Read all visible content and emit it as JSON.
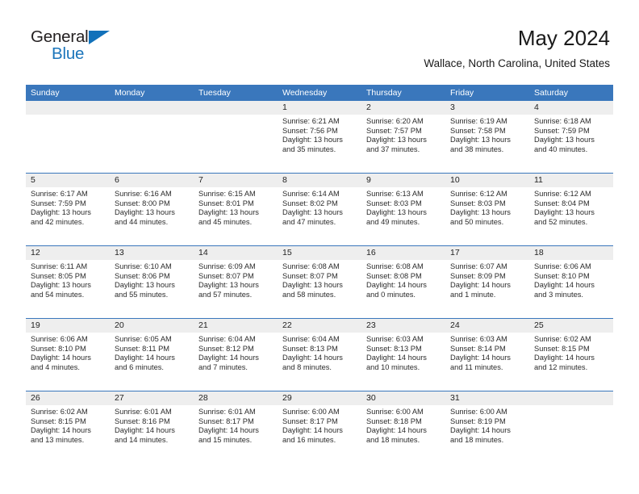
{
  "logo": {
    "line1": "General",
    "line2": "Blue",
    "triangle_color": "#1271ba",
    "blue_color": "#1b75bb"
  },
  "header": {
    "title": "May 2024",
    "subtitle": "Wallace, North Carolina, United States"
  },
  "theme": {
    "header_blue": "#3a77bc",
    "day_band_gray": "#eeeeee"
  },
  "weekdays": [
    "Sunday",
    "Monday",
    "Tuesday",
    "Wednesday",
    "Thursday",
    "Friday",
    "Saturday"
  ],
  "weeks": [
    [
      {
        "day": "",
        "lines": []
      },
      {
        "day": "",
        "lines": []
      },
      {
        "day": "",
        "lines": []
      },
      {
        "day": "1",
        "lines": [
          "Sunrise: 6:21 AM",
          "Sunset: 7:56 PM",
          "Daylight: 13 hours",
          "and 35 minutes."
        ]
      },
      {
        "day": "2",
        "lines": [
          "Sunrise: 6:20 AM",
          "Sunset: 7:57 PM",
          "Daylight: 13 hours",
          "and 37 minutes."
        ]
      },
      {
        "day": "3",
        "lines": [
          "Sunrise: 6:19 AM",
          "Sunset: 7:58 PM",
          "Daylight: 13 hours",
          "and 38 minutes."
        ]
      },
      {
        "day": "4",
        "lines": [
          "Sunrise: 6:18 AM",
          "Sunset: 7:59 PM",
          "Daylight: 13 hours",
          "and 40 minutes."
        ]
      }
    ],
    [
      {
        "day": "5",
        "lines": [
          "Sunrise: 6:17 AM",
          "Sunset: 7:59 PM",
          "Daylight: 13 hours",
          "and 42 minutes."
        ]
      },
      {
        "day": "6",
        "lines": [
          "Sunrise: 6:16 AM",
          "Sunset: 8:00 PM",
          "Daylight: 13 hours",
          "and 44 minutes."
        ]
      },
      {
        "day": "7",
        "lines": [
          "Sunrise: 6:15 AM",
          "Sunset: 8:01 PM",
          "Daylight: 13 hours",
          "and 45 minutes."
        ]
      },
      {
        "day": "8",
        "lines": [
          "Sunrise: 6:14 AM",
          "Sunset: 8:02 PM",
          "Daylight: 13 hours",
          "and 47 minutes."
        ]
      },
      {
        "day": "9",
        "lines": [
          "Sunrise: 6:13 AM",
          "Sunset: 8:03 PM",
          "Daylight: 13 hours",
          "and 49 minutes."
        ]
      },
      {
        "day": "10",
        "lines": [
          "Sunrise: 6:12 AM",
          "Sunset: 8:03 PM",
          "Daylight: 13 hours",
          "and 50 minutes."
        ]
      },
      {
        "day": "11",
        "lines": [
          "Sunrise: 6:12 AM",
          "Sunset: 8:04 PM",
          "Daylight: 13 hours",
          "and 52 minutes."
        ]
      }
    ],
    [
      {
        "day": "12",
        "lines": [
          "Sunrise: 6:11 AM",
          "Sunset: 8:05 PM",
          "Daylight: 13 hours",
          "and 54 minutes."
        ]
      },
      {
        "day": "13",
        "lines": [
          "Sunrise: 6:10 AM",
          "Sunset: 8:06 PM",
          "Daylight: 13 hours",
          "and 55 minutes."
        ]
      },
      {
        "day": "14",
        "lines": [
          "Sunrise: 6:09 AM",
          "Sunset: 8:07 PM",
          "Daylight: 13 hours",
          "and 57 minutes."
        ]
      },
      {
        "day": "15",
        "lines": [
          "Sunrise: 6:08 AM",
          "Sunset: 8:07 PM",
          "Daylight: 13 hours",
          "and 58 minutes."
        ]
      },
      {
        "day": "16",
        "lines": [
          "Sunrise: 6:08 AM",
          "Sunset: 8:08 PM",
          "Daylight: 14 hours",
          "and 0 minutes."
        ]
      },
      {
        "day": "17",
        "lines": [
          "Sunrise: 6:07 AM",
          "Sunset: 8:09 PM",
          "Daylight: 14 hours",
          "and 1 minute."
        ]
      },
      {
        "day": "18",
        "lines": [
          "Sunrise: 6:06 AM",
          "Sunset: 8:10 PM",
          "Daylight: 14 hours",
          "and 3 minutes."
        ]
      }
    ],
    [
      {
        "day": "19",
        "lines": [
          "Sunrise: 6:06 AM",
          "Sunset: 8:10 PM",
          "Daylight: 14 hours",
          "and 4 minutes."
        ]
      },
      {
        "day": "20",
        "lines": [
          "Sunrise: 6:05 AM",
          "Sunset: 8:11 PM",
          "Daylight: 14 hours",
          "and 6 minutes."
        ]
      },
      {
        "day": "21",
        "lines": [
          "Sunrise: 6:04 AM",
          "Sunset: 8:12 PM",
          "Daylight: 14 hours",
          "and 7 minutes."
        ]
      },
      {
        "day": "22",
        "lines": [
          "Sunrise: 6:04 AM",
          "Sunset: 8:13 PM",
          "Daylight: 14 hours",
          "and 8 minutes."
        ]
      },
      {
        "day": "23",
        "lines": [
          "Sunrise: 6:03 AM",
          "Sunset: 8:13 PM",
          "Daylight: 14 hours",
          "and 10 minutes."
        ]
      },
      {
        "day": "24",
        "lines": [
          "Sunrise: 6:03 AM",
          "Sunset: 8:14 PM",
          "Daylight: 14 hours",
          "and 11 minutes."
        ]
      },
      {
        "day": "25",
        "lines": [
          "Sunrise: 6:02 AM",
          "Sunset: 8:15 PM",
          "Daylight: 14 hours",
          "and 12 minutes."
        ]
      }
    ],
    [
      {
        "day": "26",
        "lines": [
          "Sunrise: 6:02 AM",
          "Sunset: 8:15 PM",
          "Daylight: 14 hours",
          "and 13 minutes."
        ]
      },
      {
        "day": "27",
        "lines": [
          "Sunrise: 6:01 AM",
          "Sunset: 8:16 PM",
          "Daylight: 14 hours",
          "and 14 minutes."
        ]
      },
      {
        "day": "28",
        "lines": [
          "Sunrise: 6:01 AM",
          "Sunset: 8:17 PM",
          "Daylight: 14 hours",
          "and 15 minutes."
        ]
      },
      {
        "day": "29",
        "lines": [
          "Sunrise: 6:00 AM",
          "Sunset: 8:17 PM",
          "Daylight: 14 hours",
          "and 16 minutes."
        ]
      },
      {
        "day": "30",
        "lines": [
          "Sunrise: 6:00 AM",
          "Sunset: 8:18 PM",
          "Daylight: 14 hours",
          "and 18 minutes."
        ]
      },
      {
        "day": "31",
        "lines": [
          "Sunrise: 6:00 AM",
          "Sunset: 8:19 PM",
          "Daylight: 14 hours",
          "and 18 minutes."
        ]
      },
      {
        "day": "",
        "lines": []
      }
    ]
  ]
}
